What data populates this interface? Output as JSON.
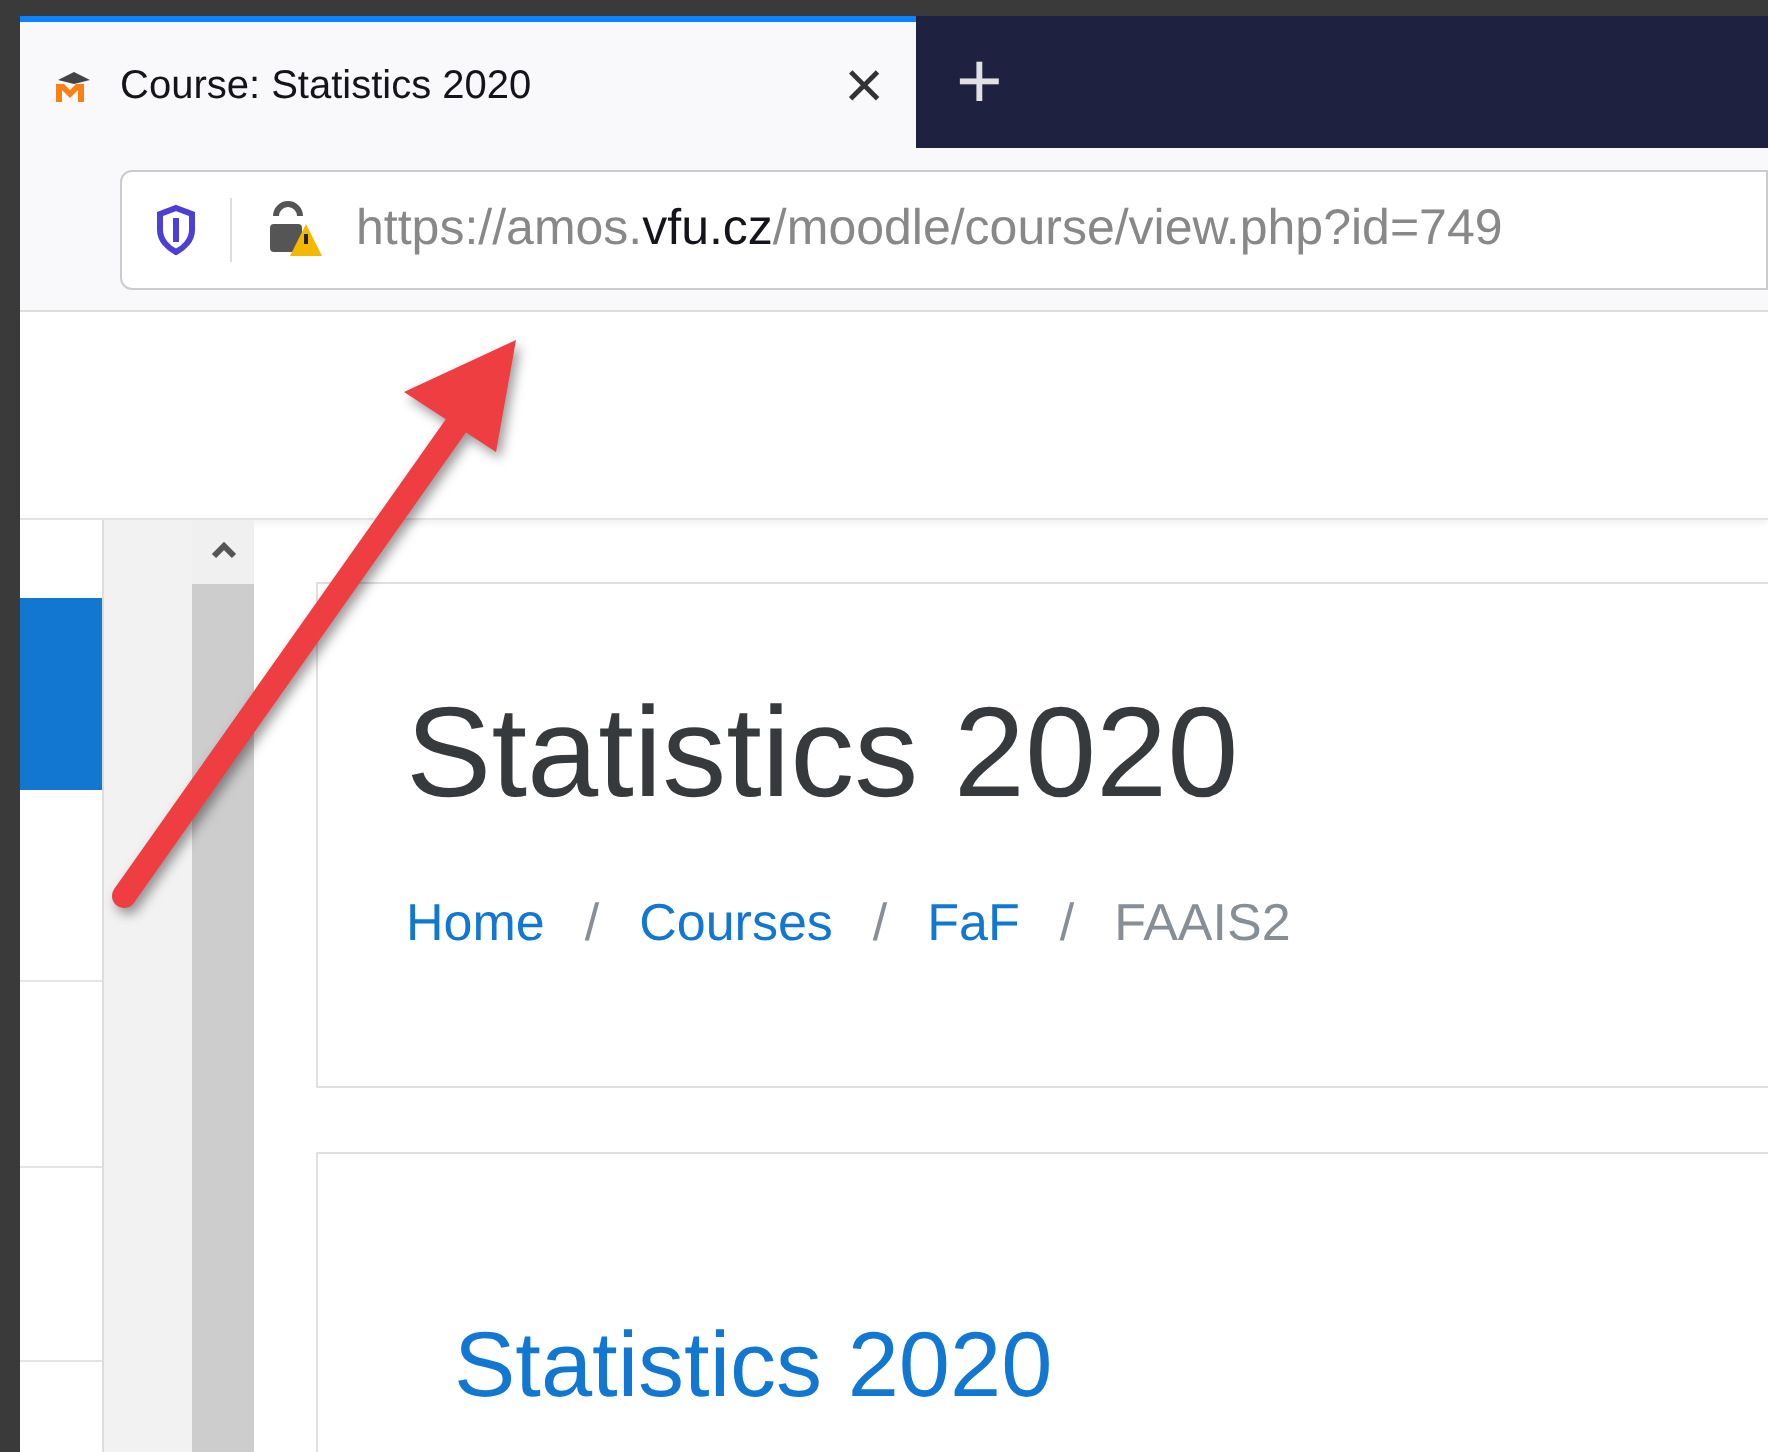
{
  "tab": {
    "title": "Course: Statistics 2020",
    "close": "×",
    "new_tab": "+"
  },
  "address_bar": {
    "url_parts": [
      {
        "text": "https://amos.",
        "emphasis": false
      },
      {
        "text": "vfu.cz",
        "emphasis": true
      },
      {
        "text": "/moodle/course/view.php?id=749",
        "emphasis": false
      }
    ]
  },
  "page_header": {
    "title": "Statistics 2020",
    "breadcrumb": [
      {
        "label": "Home",
        "kind": "link"
      },
      {
        "label": "Courses",
        "kind": "link"
      },
      {
        "label": "FaF",
        "kind": "link"
      },
      {
        "label": "FAAIS2",
        "kind": "current"
      }
    ],
    "separator": "/"
  },
  "course_section": {
    "title": "Statistics 2020"
  }
}
